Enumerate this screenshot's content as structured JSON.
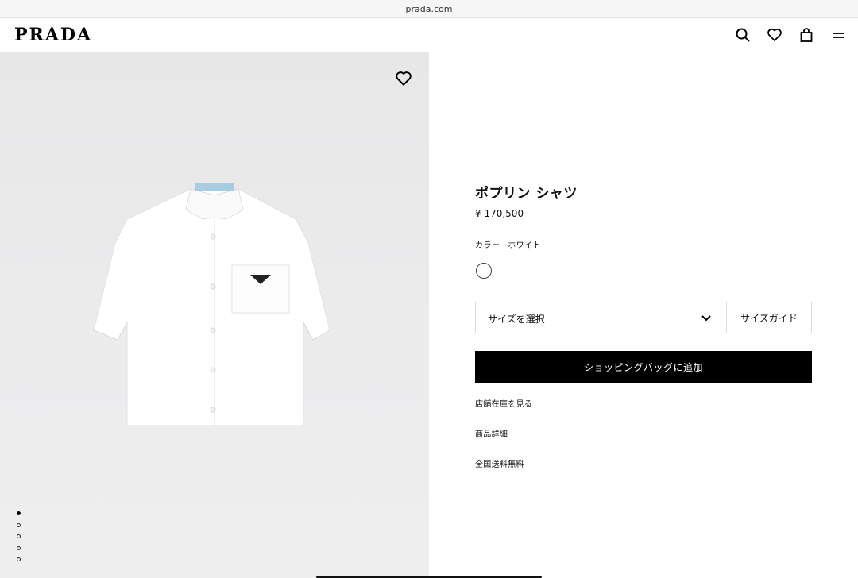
{
  "browser": {
    "url": "prada.com"
  },
  "header": {
    "logo": "PRADA",
    "icons": [
      "search-icon",
      "heart-icon",
      "bag-icon",
      "menu-icon"
    ]
  },
  "gallery": {
    "image": "white-short-sleeve-poplin-shirt",
    "favorite_icon": "heart-icon",
    "slide_count": 5,
    "active_slide": 1
  },
  "product": {
    "title": "ポプリン シャツ",
    "price": "¥ 170,500",
    "color_label": "カラー",
    "color_value": "ホワイト",
    "swatch_color": "#ffffff"
  },
  "size": {
    "select_label": "サイズを選択",
    "guide_label": "サイズガイド"
  },
  "actions": {
    "add_to_bag": "ショッピングバッグに追加"
  },
  "links": {
    "store_stock": "店舗在庫を見る",
    "details": "商品詳細",
    "shipping": "全国送料無料"
  },
  "colors": {
    "accent": "#000000",
    "image_bg": "#e9e9ea"
  }
}
